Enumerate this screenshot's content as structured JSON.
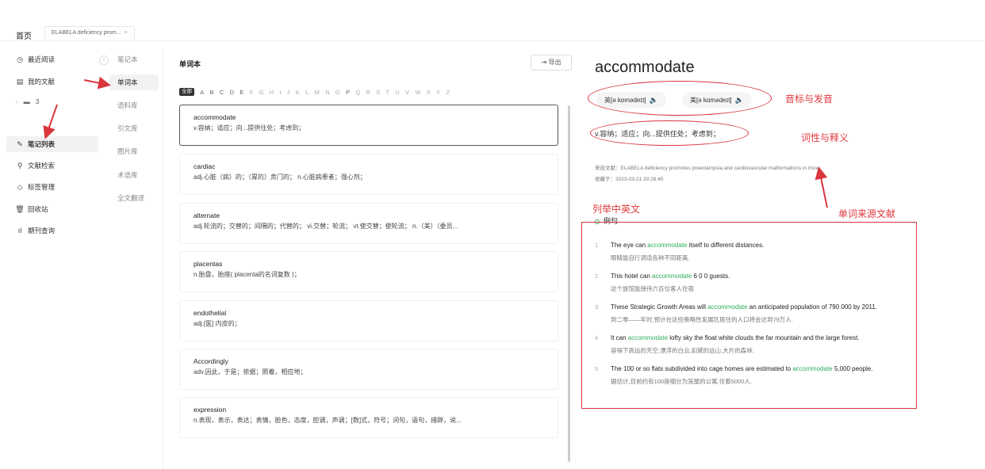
{
  "tabs": {
    "home": "首页",
    "doc": "ELABELA deficiency prom...",
    "close": "×"
  },
  "sidebar": {
    "items": [
      {
        "label": "最近阅读",
        "icon": "clock-icon"
      },
      {
        "label": "我的文献",
        "icon": "document-icon"
      },
      {
        "label": "笔记列表",
        "icon": "pen-icon"
      },
      {
        "label": "文献检索",
        "icon": "search-icon"
      },
      {
        "label": "标签管理",
        "icon": "tag-icon"
      },
      {
        "label": "回收站",
        "icon": "trash-icon"
      },
      {
        "label": "期刊查询",
        "icon": "chart-icon"
      }
    ],
    "folder_label": "3",
    "active": "笔记列表"
  },
  "subnav": {
    "items": [
      "笔记本",
      "单词本",
      "语料库",
      "引文库",
      "图片库",
      "术语库",
      "全文翻译"
    ],
    "active": "单词本"
  },
  "wordlist": {
    "title": "单词本",
    "export_label": "导出",
    "filter_all": "全部",
    "letters": [
      "A",
      "B",
      "C",
      "D",
      "E",
      "F",
      "G",
      "H",
      "I",
      "J",
      "K",
      "L",
      "M",
      "N",
      "O",
      "P",
      "Q",
      "R",
      "S",
      "T",
      "U",
      "V",
      "W",
      "X",
      "Y",
      "Z"
    ],
    "words": [
      {
        "word": "accommodate",
        "def": "v.容纳；适应；向...提供住处；考虑到；"
      },
      {
        "word": "cardiac",
        "def": "adj.心脏（病）的；（胃的）贲门的； n.心脏病患者；强心剂；"
      },
      {
        "word": "alternate",
        "def": "adj.轮流的；交替的；间隔的；代替的； vi.交替；轮流； vt.使交替；使轮流； n.（美）（委员..."
      },
      {
        "word": "placentas",
        "def": "n.胎盘，胎座( placenta的名词复数 )；"
      },
      {
        "word": "endothelial",
        "def": "adj.[医] 内皮的；"
      },
      {
        "word": "Accordingly",
        "def": "adv.因此，于是；依据；照着，相应地；"
      },
      {
        "word": "expression",
        "def": "n.表现，表示，表达；表情，脸色，态度，腔调，声调；[数]式，符号；词句，语句，措辞，说..."
      }
    ]
  },
  "detail": {
    "word": "accommodate",
    "uk": "英[ə kɒmədeɪt]",
    "us": "美[ə kɑmədeɪt]",
    "definition": "v.容纳；适应；向...提供住处；考虑到；",
    "source": "来自文献：ELABELA deficiency promotes preeclampsia and cardiovascular malformations in mice",
    "collected": "收藏于：2023-03-21 20:28:45",
    "examples_title": "例句",
    "examples": [
      {
        "no": "1",
        "pre": "The eye can ",
        "kw": "accommodate",
        "post": " itself to different distances.",
        "zh": "眼睛能自行调适各种不同距离."
      },
      {
        "no": "2",
        "pre": "This hotel can ",
        "kw": "accommodate",
        "post": " 6 0 0 guests.",
        "zh": "这个旅馆能接待六百位客人住宿."
      },
      {
        "no": "3",
        "pre": "These Strategic Growth Areas will ",
        "kw": "accommodate",
        "post": " an anticipated population of 790 000 by 2011.",
        "zh": "到二零——年时,预计在这些策略性发展区居住的人口将会达到79万人."
      },
      {
        "no": "4",
        "pre": "It can ",
        "kw": "accommodate",
        "post": " lofty sky the float white clouds the far mountain and the large forest.",
        "zh": "容得下高远的天空,漂浮的白云,如黛的远山,大片的森林."
      },
      {
        "no": "5",
        "pre": "The 100 or so flats subdivided into cage homes are estimated to ",
        "kw": "accommodate",
        "post": " 5,000 people.",
        "zh": "据估计,目前约有100座细分为笼屋的公寓,住着5000人."
      }
    ]
  },
  "annotations": {
    "phonetic": "音标与发音",
    "pos": "词性与释义",
    "examples": "列举中英文",
    "source": "单词来源文献"
  },
  "colors": {
    "accent_green": "#2fae5e",
    "annotation_red": "#d9363e"
  }
}
